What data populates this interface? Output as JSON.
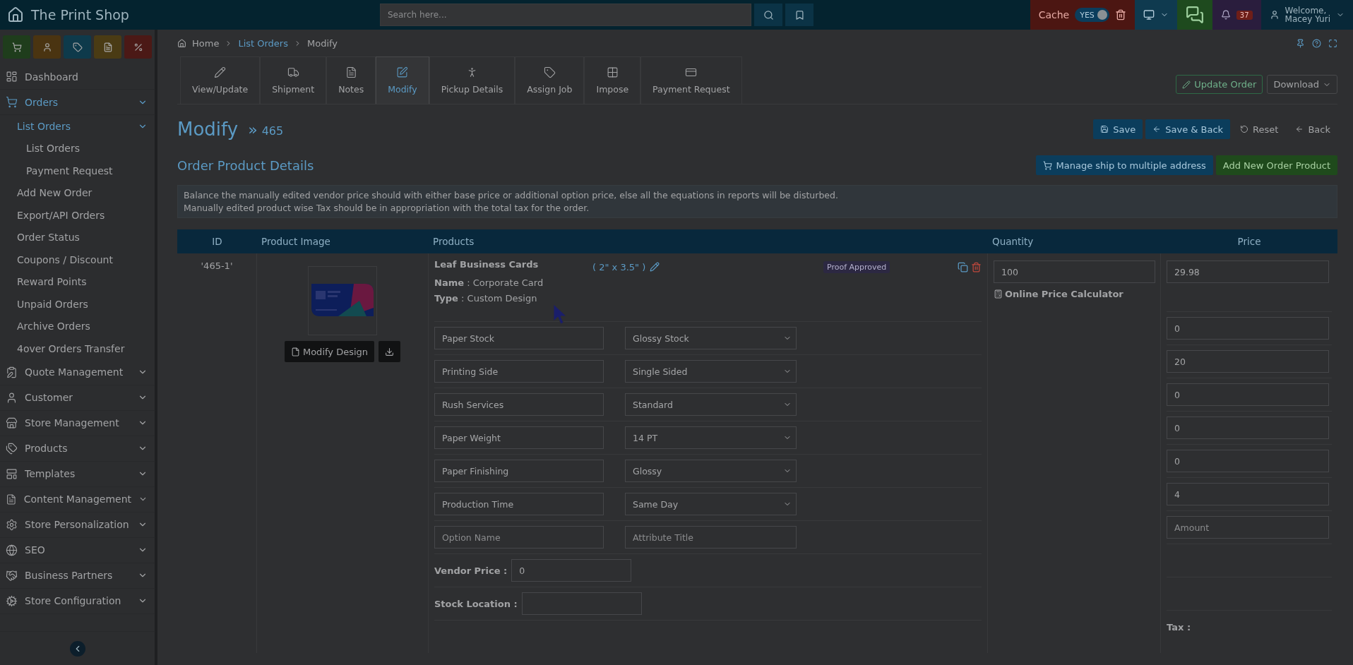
{
  "app": {
    "title": "The Print Shop"
  },
  "search": {
    "placeholder": "Search here..."
  },
  "topbar": {
    "cache_label": "Cache",
    "cache_toggle": {
      "label": "YES",
      "on": true
    },
    "notifications": "37",
    "welcome": "Welcome,",
    "user": "Macey Yuri"
  },
  "quick_actions": [
    {
      "color": "#1f3d1c"
    },
    {
      "color": "#4a3411"
    },
    {
      "color": "#0e3a4b"
    },
    {
      "color": "#4a3b14"
    },
    {
      "color": "#4b1916"
    }
  ],
  "sidebar": {
    "items": [
      {
        "label": "Dashboard",
        "selected": false
      },
      {
        "label": "Orders",
        "selected": true,
        "expanded": true,
        "children": [
          {
            "label": "List Orders",
            "selected": true,
            "expanded": true,
            "children": [
              {
                "label": "List Orders",
                "selected": false
              },
              {
                "label": "Payment Request",
                "selected": false
              }
            ]
          },
          {
            "label": "Add New Order",
            "selected": false
          },
          {
            "label": "Export/API Orders",
            "selected": false
          },
          {
            "label": "Order Status",
            "selected": false
          },
          {
            "label": "Coupons / Discount",
            "selected": false
          },
          {
            "label": "Reward Points",
            "selected": false
          },
          {
            "label": "Unpaid Orders",
            "selected": false
          },
          {
            "label": "Archive Orders",
            "selected": false
          },
          {
            "label": "4over Orders Transfer",
            "selected": false
          }
        ]
      },
      {
        "label": "Quote Management",
        "selected": false,
        "expanded": false
      },
      {
        "label": "Customer",
        "selected": false,
        "expanded": false
      },
      {
        "label": "Store Management",
        "selected": false,
        "expanded": false
      },
      {
        "label": "Products",
        "selected": false,
        "expanded": false
      },
      {
        "label": "Templates",
        "selected": false,
        "expanded": false
      },
      {
        "label": "Content Management",
        "selected": false,
        "expanded": false
      },
      {
        "label": "Store Personalization",
        "selected": false,
        "expanded": false
      },
      {
        "label": "SEO",
        "selected": false,
        "expanded": false
      },
      {
        "label": "Business Partners",
        "selected": false,
        "expanded": false
      },
      {
        "label": "Store Configuration",
        "selected": false,
        "expanded": false
      }
    ]
  },
  "breadcrumb": [
    "Home",
    "List Orders",
    "Modify"
  ],
  "tabs": [
    {
      "label": "View/Update",
      "selected": false
    },
    {
      "label": "Shipment",
      "selected": false
    },
    {
      "label": "Notes",
      "selected": false
    },
    {
      "label": "Modify",
      "selected": true
    },
    {
      "label": "Pickup Details",
      "selected": false
    },
    {
      "label": "Assign Job",
      "selected": false
    },
    {
      "label": "Impose",
      "selected": false
    },
    {
      "label": "Payment Request",
      "selected": false
    }
  ],
  "header_actions": {
    "update": "Update Order",
    "download": "Download"
  },
  "page": {
    "title": "Modify",
    "separator": "»",
    "order_number": "465"
  },
  "form_actions": {
    "save": "Save",
    "save_back": "Save & Back",
    "reset": "Reset",
    "back": "Back"
  },
  "section": {
    "title": "Order Product Details",
    "manage": "Manage ship to multiple address",
    "add": "Add New Order Product"
  },
  "notice": [
    "Balance the manually edited vendor price should with either base price or additional option price, else all the equations in reports will be disturbed.",
    "Manually edited product wise Tax should be in appropriation with the total tax for the order."
  ],
  "table": {
    "columns": [
      "ID",
      "Product Image",
      "Products",
      "Quantity",
      "Price"
    ],
    "row": {
      "id": "'465-1'",
      "image": {
        "kind": "picture"
      },
      "modify_design": "Modify Design",
      "product": "Leaf Business Cards",
      "size": "( 2\" x 3.5\" )",
      "details": [
        "**Name** : Corporate Card",
        "**Type** : Custom Design"
      ],
      "status": "Proof Approved",
      "quantity": "100",
      "calculator": "Online Price Calculator",
      "price": "29.98",
      "options": [
        {
          "name": "Paper Stock",
          "value": "Glossy Stock",
          "price": "0"
        },
        {
          "name": "Printing Side",
          "value": "Single Sided",
          "price": "20"
        },
        {
          "name": "Rush Services",
          "value": "Standard",
          "price": "0"
        },
        {
          "name": "Paper Weight",
          "value": "14 PT",
          "price": "0"
        },
        {
          "name": "Paper Finishing",
          "value": "Glossy",
          "price": "0"
        },
        {
          "name": "Production Time",
          "value": "Same Day",
          "price": "4"
        }
      ],
      "new_option": {
        "name_placeholder": "Option Name",
        "attribute_placeholder": "Attribute Title",
        "amount_placeholder": "Amount"
      },
      "vendor_price": {
        "label": "Vendor Price :",
        "value": "0"
      },
      "stock_location": {
        "label": "Stock Location :"
      },
      "tax_label": "Tax :"
    }
  }
}
